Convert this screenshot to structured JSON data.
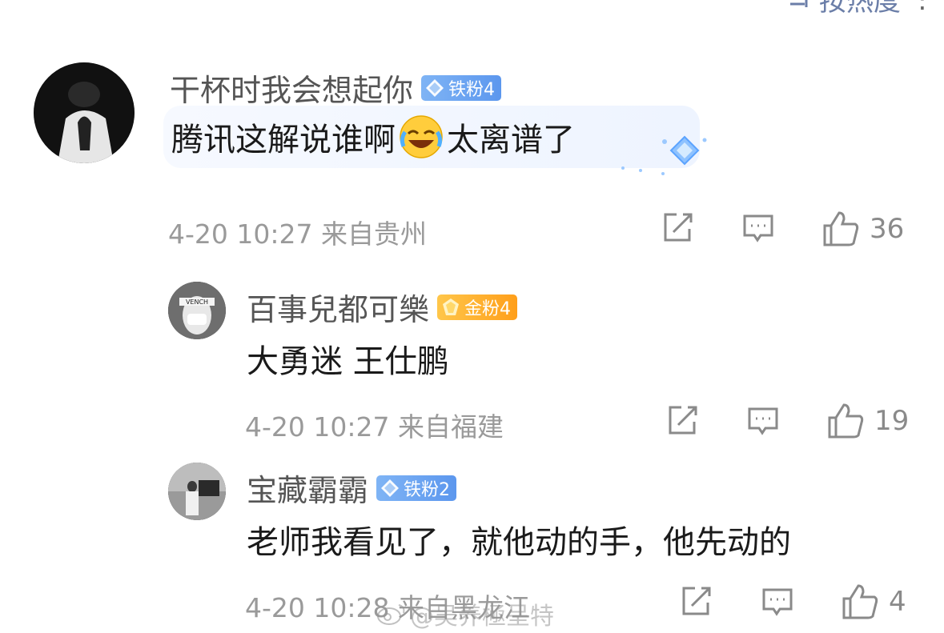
{
  "top_bar": {
    "sort_label": "按热度"
  },
  "comments": [
    {
      "username": "干杯时我会想起你",
      "badge": "铁粉4",
      "text_before": "腾讯这解说谁啊",
      "text_after": "太离谱了",
      "meta": "4-20 10:27 来自贵州",
      "likes": "36"
    },
    {
      "username": "百事兒都可樂",
      "badge": "金粉4",
      "text": "大勇迷 王仕鹏",
      "meta": "4-20 10:27 来自福建",
      "likes": "19"
    },
    {
      "username": "宝藏霸霸",
      "badge": "铁粉2",
      "text": "老师我看见了，就他动的手，他先动的",
      "meta": "4-20 10:28 来自黑龙江",
      "likes": "4"
    }
  ],
  "watermark": "@吴养極呈特",
  "colors": {
    "iron_badge": "#5c97ee",
    "gold_badge": "#ff9f1a",
    "sort_accent": "#6b7ea8"
  }
}
